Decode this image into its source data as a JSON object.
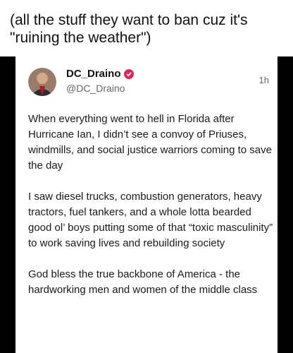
{
  "caption": "(all the stuff they want to ban cuz it's \"ruining the weather\")",
  "post": {
    "author": "DC_Draino",
    "handle": "@DC_Draino",
    "time": "1h",
    "paragraphs": [
      "When everything went to hell in Florida after Hurricane Ian, I didn’t see a convoy of Priuses, windmills, and social justice warriors coming to save the day",
      "I saw diesel trucks, combustion generators, heavy tractors, fuel tankers, and a whole lotta bearded good ol’ boys putting some of that “toxic masculinity” to work saving lives and rebuilding society",
      "God bless the true backbone of America - the hardworking men and women of the middle class"
    ]
  },
  "colors": {
    "verified_badge": "#e0245e",
    "background": "#000000"
  }
}
